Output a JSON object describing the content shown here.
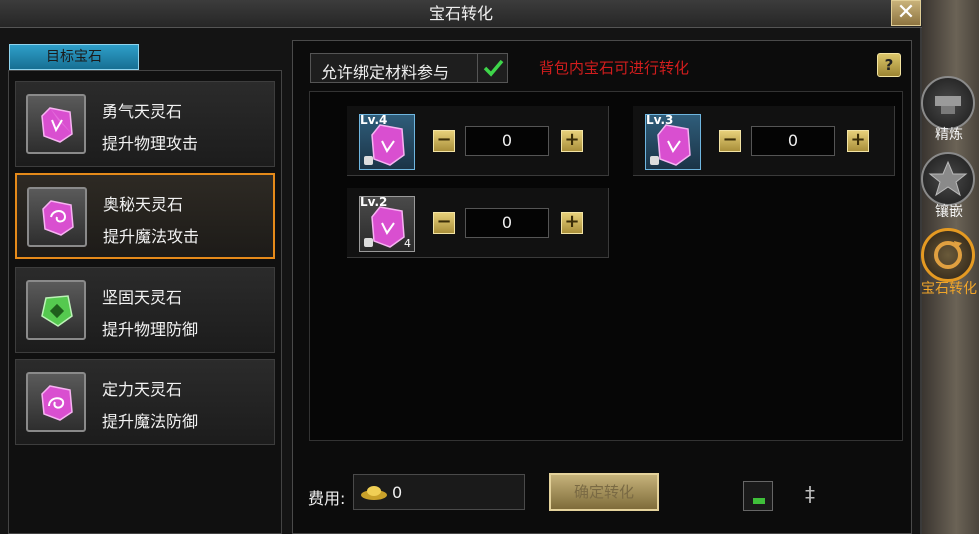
{
  "window": {
    "title": "宝石转化",
    "close_label": "✕"
  },
  "target_tab": {
    "label": "目标宝石"
  },
  "gems": [
    {
      "name": "勇气天灵石",
      "desc": "提升物理攻击",
      "color": "#e05bd8"
    },
    {
      "name": "奥秘天灵石",
      "desc": "提升魔法攻击",
      "color": "#e05bd8"
    },
    {
      "name": "坚固天灵石",
      "desc": "提升物理防御",
      "color": "#4fc54a"
    },
    {
      "name": "定力天灵石",
      "desc": "提升魔法防御",
      "color": "#e05bd8"
    }
  ],
  "options": {
    "allow_bound_label": "允许绑定材料参与",
    "hint": "背包内宝石可进行转化",
    "help_label": "?"
  },
  "slots": [
    {
      "level": "Lv.4",
      "count": "",
      "qty": "0"
    },
    {
      "level": "Lv.3",
      "count": "",
      "qty": "0"
    },
    {
      "level": "Lv.2",
      "count": "4",
      "qty": "0"
    }
  ],
  "footer": {
    "cost_label": "费用:",
    "cost_value": "0",
    "convert_label": "确定转化"
  },
  "sidebar": [
    {
      "label": "精炼",
      "icon": "anvil-icon"
    },
    {
      "label": "镶嵌",
      "icon": "star-icon"
    },
    {
      "label": "宝石转化",
      "icon": "convert-icon"
    }
  ]
}
